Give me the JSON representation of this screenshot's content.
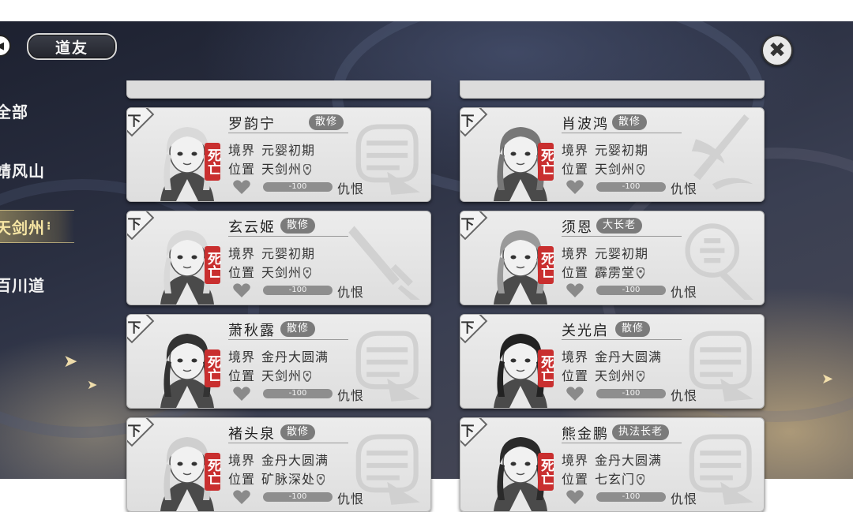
{
  "header": {
    "title": "道友"
  },
  "sidebar": {
    "items": [
      {
        "label": "全部",
        "active": false
      },
      {
        "label": "靖风山",
        "active": false
      },
      {
        "label": "天剑州",
        "active": true
      },
      {
        "label": "百川道",
        "active": false
      }
    ]
  },
  "labels": {
    "realm_key": "境界",
    "location_key": "位置",
    "hatred": "仇恨",
    "down": "下",
    "dead": "死亡"
  },
  "cards": [
    {
      "name": "罗韵宁",
      "tag": "散修",
      "realm": "元婴初期",
      "location": "天剑州",
      "favor": "-100",
      "emblem": "fist-emblem-icon"
    },
    {
      "name": "肖波鸿",
      "tag": "散修",
      "realm": "元婴初期",
      "location": "天剑州",
      "favor": "-100",
      "emblem": "flame-sword-emblem-icon"
    },
    {
      "name": "玄云姬",
      "tag": "散修",
      "realm": "元婴初期",
      "location": "天剑州",
      "favor": "-100",
      "emblem": "sword-emblem-icon"
    },
    {
      "name": "须恩",
      "tag": "大长老",
      "realm": "元婴初期",
      "location": "霹雳堂",
      "favor": "-100",
      "emblem": "hammer-emblem-icon"
    },
    {
      "name": "萧秋露",
      "tag": "散修",
      "realm": "金丹大圆满",
      "location": "天剑州",
      "favor": "-100",
      "emblem": "fist-emblem-icon"
    },
    {
      "name": "关光启",
      "tag": "散修",
      "realm": "金丹大圆满",
      "location": "天剑州",
      "favor": "-100",
      "emblem": "fist-emblem-icon"
    },
    {
      "name": "褚头泉",
      "tag": "散修",
      "realm": "金丹大圆满",
      "location": "矿脉深处",
      "favor": "-100",
      "emblem": "fist-emblem-icon"
    },
    {
      "name": "熊金鹏",
      "tag": "执法长老",
      "realm": "金丹大圆满",
      "location": "七玄门",
      "favor": "-100",
      "emblem": "fist-emblem-icon"
    }
  ],
  "colors": {
    "dead_badge": "#c92f2f",
    "tag_bg": "#7b7b7b",
    "active_tab": "#f7e6a4"
  }
}
